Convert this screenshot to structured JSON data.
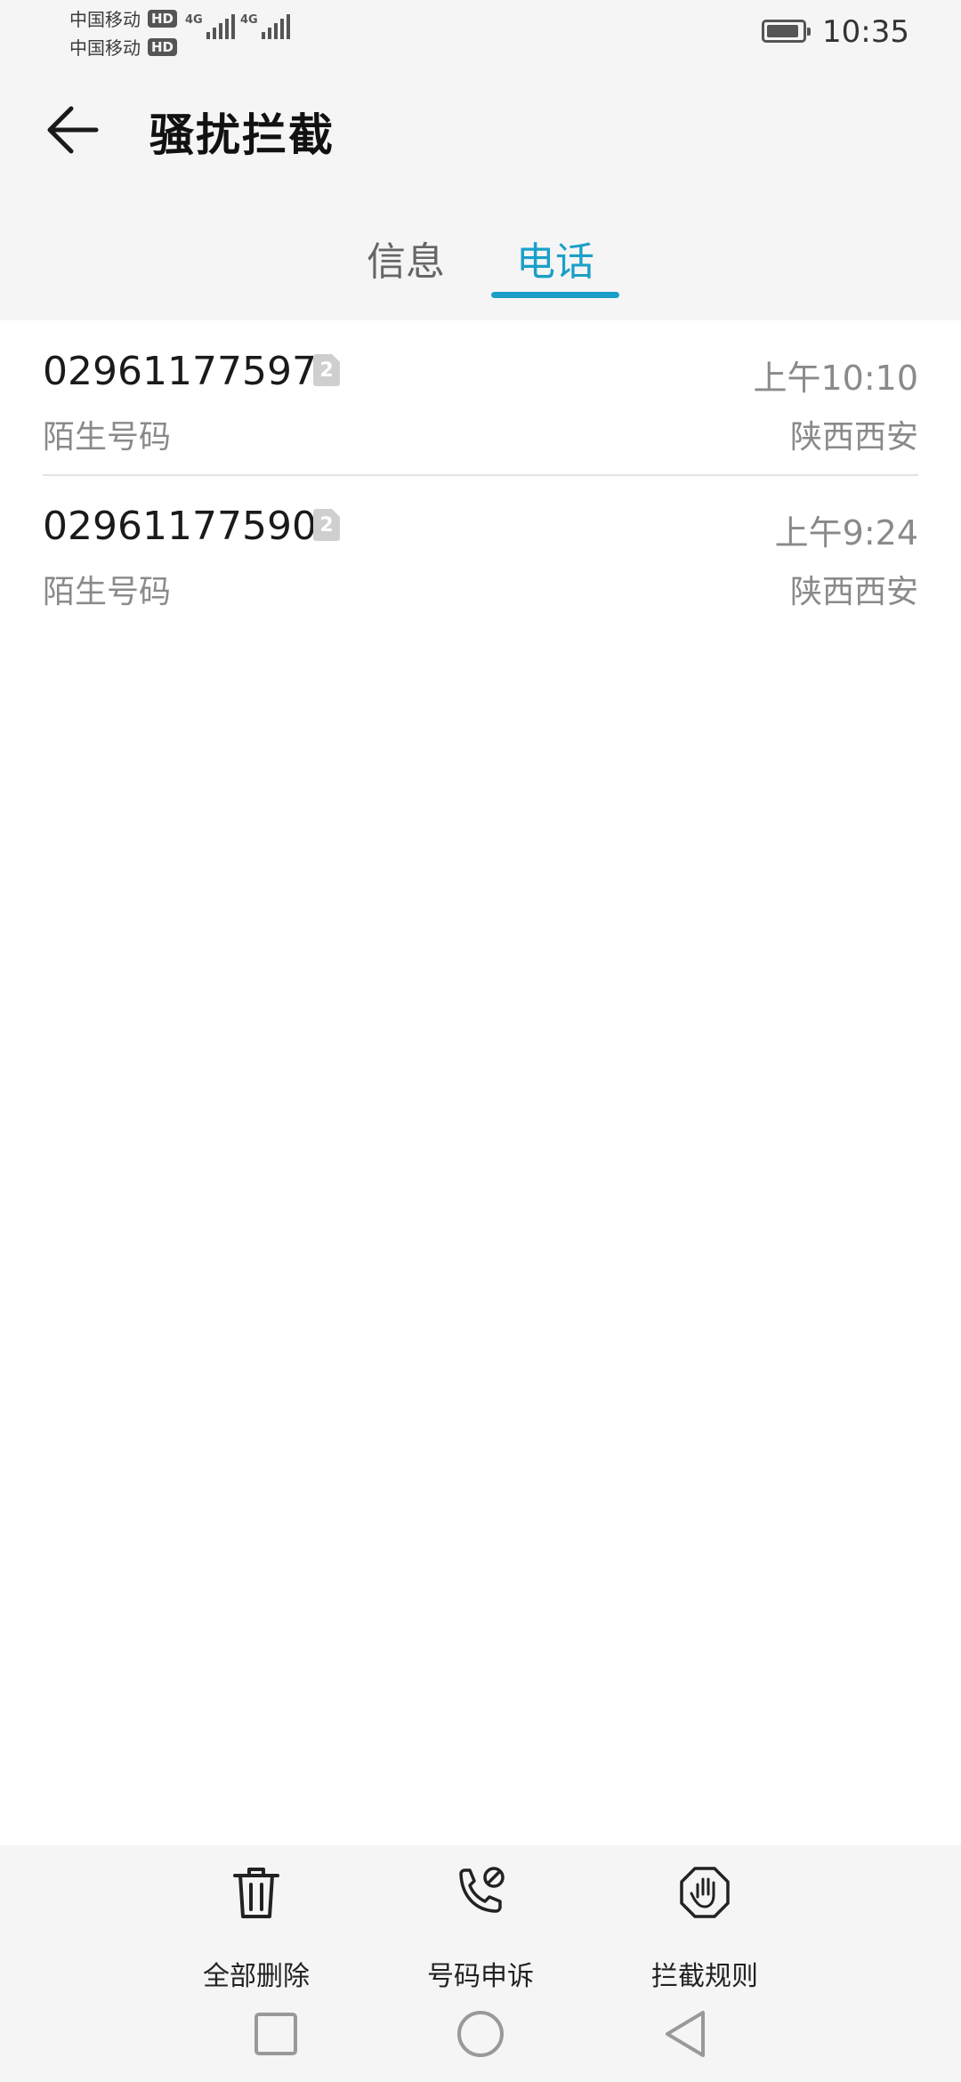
{
  "status_bar": {
    "carrier_1": "中国移动",
    "carrier_2": "中国移动",
    "hd_label": "HD",
    "network_1": "4G",
    "network_2": "4G",
    "time": "10:35"
  },
  "header": {
    "title": "骚扰拦截",
    "back_icon": "arrow-left-icon"
  },
  "tabs": [
    {
      "label": "信息",
      "active": false
    },
    {
      "label": "电话",
      "active": true
    }
  ],
  "calls": [
    {
      "number": "02961177597",
      "sim": "2",
      "label": "陌生号码",
      "time": "上午10:10",
      "location": "陕西西安"
    },
    {
      "number": "02961177590",
      "sim": "2",
      "label": "陌生号码",
      "time": "上午9:24",
      "location": "陕西西安"
    }
  ],
  "actions": [
    {
      "label": "全部删除",
      "icon": "trash-icon"
    },
    {
      "label": "号码申诉",
      "icon": "phone-block-icon"
    },
    {
      "label": "拦截规则",
      "icon": "hand-stop-icon"
    }
  ],
  "colors": {
    "accent": "#1aa0c8",
    "background_top": "#f5f5f5",
    "secondary_text": "#8a8a8a"
  }
}
